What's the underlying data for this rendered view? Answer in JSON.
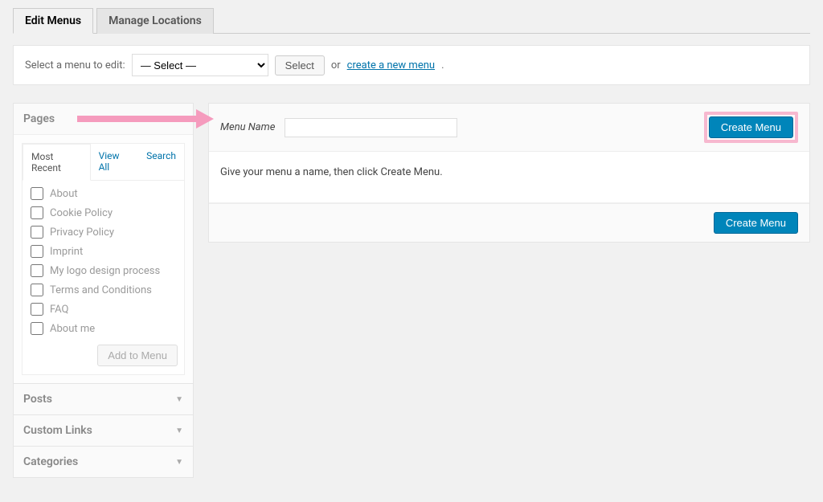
{
  "tabs": {
    "edit_menus": "Edit Menus",
    "manage_locations": "Manage Locations"
  },
  "select_bar": {
    "label": "Select a menu to edit:",
    "selected_option": "— Select —",
    "select_button": "Select",
    "or_text": "or ",
    "create_link": "create a new menu",
    "period": "."
  },
  "sidebar": {
    "pages": {
      "title": "Pages",
      "inner_tabs": {
        "most_recent": "Most Recent",
        "view_all": "View All",
        "search": "Search"
      },
      "items": [
        {
          "label": "About"
        },
        {
          "label": "Cookie Policy"
        },
        {
          "label": "Privacy Policy"
        },
        {
          "label": "Imprint"
        },
        {
          "label": "My logo design process"
        },
        {
          "label": "Terms and Conditions"
        },
        {
          "label": "FAQ"
        },
        {
          "label": "About me"
        }
      ],
      "add_button": "Add to Menu"
    },
    "posts": {
      "title": "Posts"
    },
    "custom_links": {
      "title": "Custom Links"
    },
    "categories": {
      "title": "Categories"
    }
  },
  "menu": {
    "name_label": "Menu Name",
    "name_value": "",
    "create_button": "Create Menu",
    "body_text": "Give your menu a name, then click Create Menu."
  }
}
